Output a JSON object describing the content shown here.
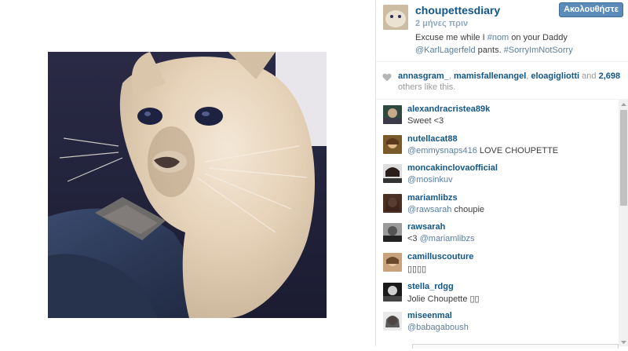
{
  "post": {
    "username": "choupettesdiary",
    "follow_label": "Ακολουθήστε",
    "time_ago": "2 μήνες πριν",
    "caption": {
      "prefix": "Excuse me while I ",
      "hashtag1": "#nom",
      "middle": " on your Daddy ",
      "mention": "@KarlLagerfeld",
      "suffix": " pants. ",
      "hashtag2": "#SorryImNotSorry"
    }
  },
  "likes": {
    "user1": "annasgram_",
    "sep1": ", ",
    "user2": "mamisfallenangel",
    "sep2": ", ",
    "user3": "eloagigliotti",
    "and": " and ",
    "count": "2,698",
    "suffix": " others like this."
  },
  "comments": [
    {
      "user": "alexandracristea89k",
      "mention": "",
      "text": "Sweet <3"
    },
    {
      "user": "nutellacat88",
      "mention": "@emmysnaps416",
      "text": " LOVE CHOUPETTE"
    },
    {
      "user": "moncakinclovaofficial",
      "mention": "@mosinkuv",
      "text": ""
    },
    {
      "user": "mariamlibzs",
      "mention": "@rawsarah",
      "text": " choupie"
    },
    {
      "user": "rawsarah",
      "mention": "",
      "text": "<3 "
    },
    {
      "user": "camilluscouture",
      "mention": "",
      "text": "▯▯▯▯"
    },
    {
      "user": "stella_rdgg",
      "mention": "",
      "text": "Jolie Choupette ▯▯"
    },
    {
      "user": "miseenmal",
      "mention": "@babagaboush",
      "text": ""
    }
  ],
  "comment4_mention": "@mariamlibzs",
  "colors": {
    "link_blue": "#125688",
    "mention_blue": "#5b7ea3",
    "follow_button": "#5b8bb8"
  },
  "icons": {
    "heart": "heart-icon",
    "scroll_up": "scroll-up-arrow-icon",
    "scroll_down": "scroll-down-arrow-icon"
  }
}
